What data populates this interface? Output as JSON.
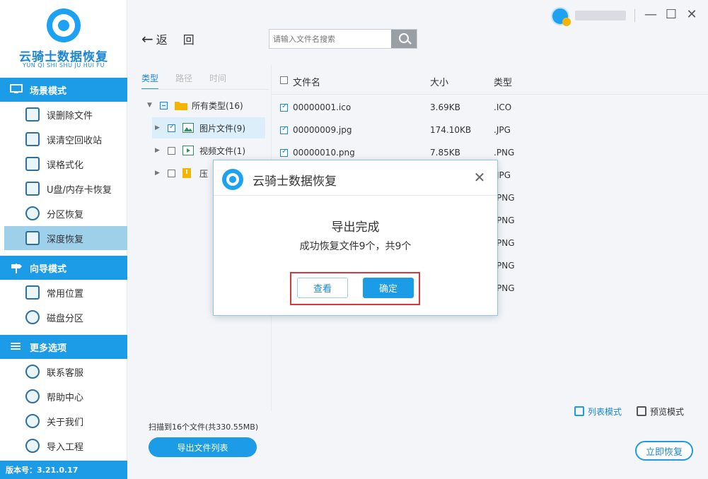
{
  "app": {
    "title": "云骑士数据恢复",
    "subtitle": "YUN QI SHI SHU JU HUI FU",
    "version": "版本号：3.21.0.17"
  },
  "sidebar": {
    "sections": [
      {
        "label": "场景模式",
        "icon": "monitor-icon",
        "items": [
          {
            "label": "误删除文件",
            "icon": "delete-file-icon"
          },
          {
            "label": "误清空回收站",
            "icon": "recycle-bin-icon"
          },
          {
            "label": "误格式化",
            "icon": "format-icon"
          },
          {
            "label": "U盘/内存卡恢复",
            "icon": "usb-drive-icon"
          },
          {
            "label": "分区恢复",
            "icon": "partition-icon"
          },
          {
            "label": "深度恢复",
            "icon": "deep-recover-icon",
            "active": true
          }
        ]
      },
      {
        "label": "向导模式",
        "icon": "signpost-icon",
        "items": [
          {
            "label": "常用位置",
            "icon": "windows-icon"
          },
          {
            "label": "磁盘分区",
            "icon": "disk-icon"
          }
        ]
      },
      {
        "label": "更多选项",
        "icon": "menu-icon",
        "items": [
          {
            "label": "联系客服",
            "icon": "phone-icon"
          },
          {
            "label": "帮助中心",
            "icon": "help-icon"
          },
          {
            "label": "关于我们",
            "icon": "info-icon"
          },
          {
            "label": "导入工程",
            "icon": "import-icon"
          }
        ]
      }
    ]
  },
  "toolbar": {
    "back_label": "返",
    "back_label2": "回",
    "search_placeholder": "请输入文件名搜索",
    "minimize": "—",
    "maximize": "☐",
    "close": "✕"
  },
  "tree": {
    "tabs": [
      "类型",
      "路径",
      "时间"
    ],
    "nodes": [
      {
        "label": "所有类型(16)",
        "state": "partial"
      },
      {
        "label": "图片文件(9)",
        "state": "checked"
      },
      {
        "label": "视频文件(1)",
        "state": "unchecked"
      },
      {
        "label": "压",
        "state": "unchecked"
      }
    ]
  },
  "table": {
    "headers": [
      "文件名",
      "大小",
      "类型"
    ],
    "rows": [
      {
        "name": "00000001.ico",
        "size": "3.69KB",
        "type": ".ICO"
      },
      {
        "name": "00000009.jpg",
        "size": "174.10KB",
        "type": ".JPG"
      },
      {
        "name": "00000010.png",
        "size": "7.85KB",
        "type": ".PNG"
      },
      {
        "name": "",
        "size": "",
        "type": "JPG"
      },
      {
        "name": "",
        "size": "",
        "type": "PNG"
      },
      {
        "name": "",
        "size": "",
        "type": "PNG"
      },
      {
        "name": "",
        "size": "",
        "type": "PNG"
      },
      {
        "name": "",
        "size": "",
        "type": "PNG"
      },
      {
        "name": "",
        "size": "",
        "type": "PNG"
      }
    ]
  },
  "footer": {
    "scan_info": "扫描到16个文件(共330.55MB)",
    "export_label": "导出文件列表",
    "list_mode": "列表模式",
    "preview_mode": "预览模式",
    "recover_label": "立即恢复"
  },
  "dialog": {
    "title": "云骑士数据恢复",
    "message": "导出完成",
    "detail": "成功恢复文件9个，共9个",
    "view_label": "查看",
    "ok_label": "确定",
    "close": "✕"
  },
  "colors": {
    "accent": "#1c9be6",
    "highlight_border": "#d9363e",
    "active_item": "#9ed0ea"
  }
}
